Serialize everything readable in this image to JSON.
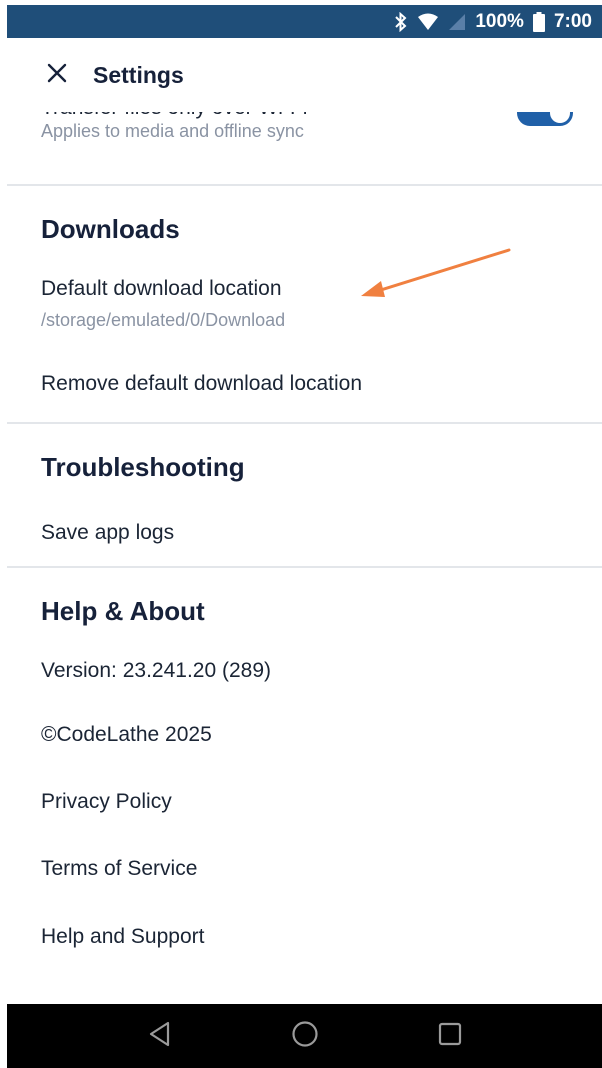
{
  "status_bar": {
    "battery_text": "100%",
    "time": "7:00",
    "icons": [
      "bluetooth-icon",
      "wifi-icon",
      "signal-icon",
      "battery-icon"
    ]
  },
  "app_bar": {
    "title": "Settings",
    "close_icon": "close-icon"
  },
  "sync": {
    "wifi_title": "Transfer files only over Wi-Fi",
    "wifi_subtitle": "Applies to media and offline sync",
    "wifi_enabled": true
  },
  "downloads": {
    "title": "Downloads",
    "default_location_label": "Default download location",
    "default_location_path": "/storage/emulated/0/Download",
    "remove_label": "Remove default download location"
  },
  "troubleshooting": {
    "title": "Troubleshooting",
    "save_logs_label": "Save app logs"
  },
  "help": {
    "title": "Help & About",
    "version": "Version: 23.241.20 (289)",
    "copyright": "©CodeLathe 2025",
    "privacy": "Privacy Policy",
    "terms": "Terms of Service",
    "support": "Help and Support"
  },
  "colors": {
    "status_bar": "#1f4e79",
    "accent": "#2060a8",
    "annotation_arrow": "#f08040"
  },
  "nav_bar": {
    "icons": [
      "back-icon",
      "home-icon",
      "recents-icon"
    ]
  }
}
